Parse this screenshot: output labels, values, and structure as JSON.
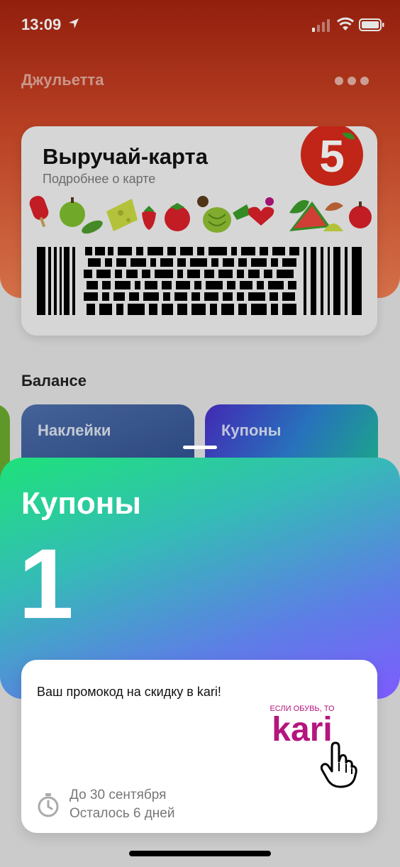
{
  "status_bar": {
    "time": "13:09",
    "icons": [
      "location-arrow-icon",
      "cellular-signal-icon",
      "wifi-icon",
      "battery-icon"
    ]
  },
  "header": {
    "user_name": "Джульетта",
    "more_icon": "ellipsis-icon"
  },
  "card": {
    "title": "Выручай-карта",
    "subtitle": "Подробнее о карте",
    "logo": "pyaterochka-5-logo",
    "logo_text": "5",
    "barcode": "pdf417-barcode"
  },
  "balance": {
    "title": "Балансе",
    "tiles": [
      {
        "label": "Наклейки"
      },
      {
        "label": "Купоны"
      }
    ]
  },
  "coupons_sheet": {
    "title": "Купоны",
    "count": "1"
  },
  "coupon": {
    "text": "Ваш промокод на скидку в kari!",
    "brand_tagline": "ЕСЛИ ОБУВЬ, ТО",
    "brand_name": "kari",
    "date": "До 30 сентября",
    "remaining": "Осталось 6 дней"
  },
  "colors": {
    "header_red": "#a3230f",
    "header_orange": "#ec7d51",
    "kari_magenta": "#b5157e",
    "sheet_green": "#1ee27a",
    "sheet_purple": "#7e5bff"
  }
}
